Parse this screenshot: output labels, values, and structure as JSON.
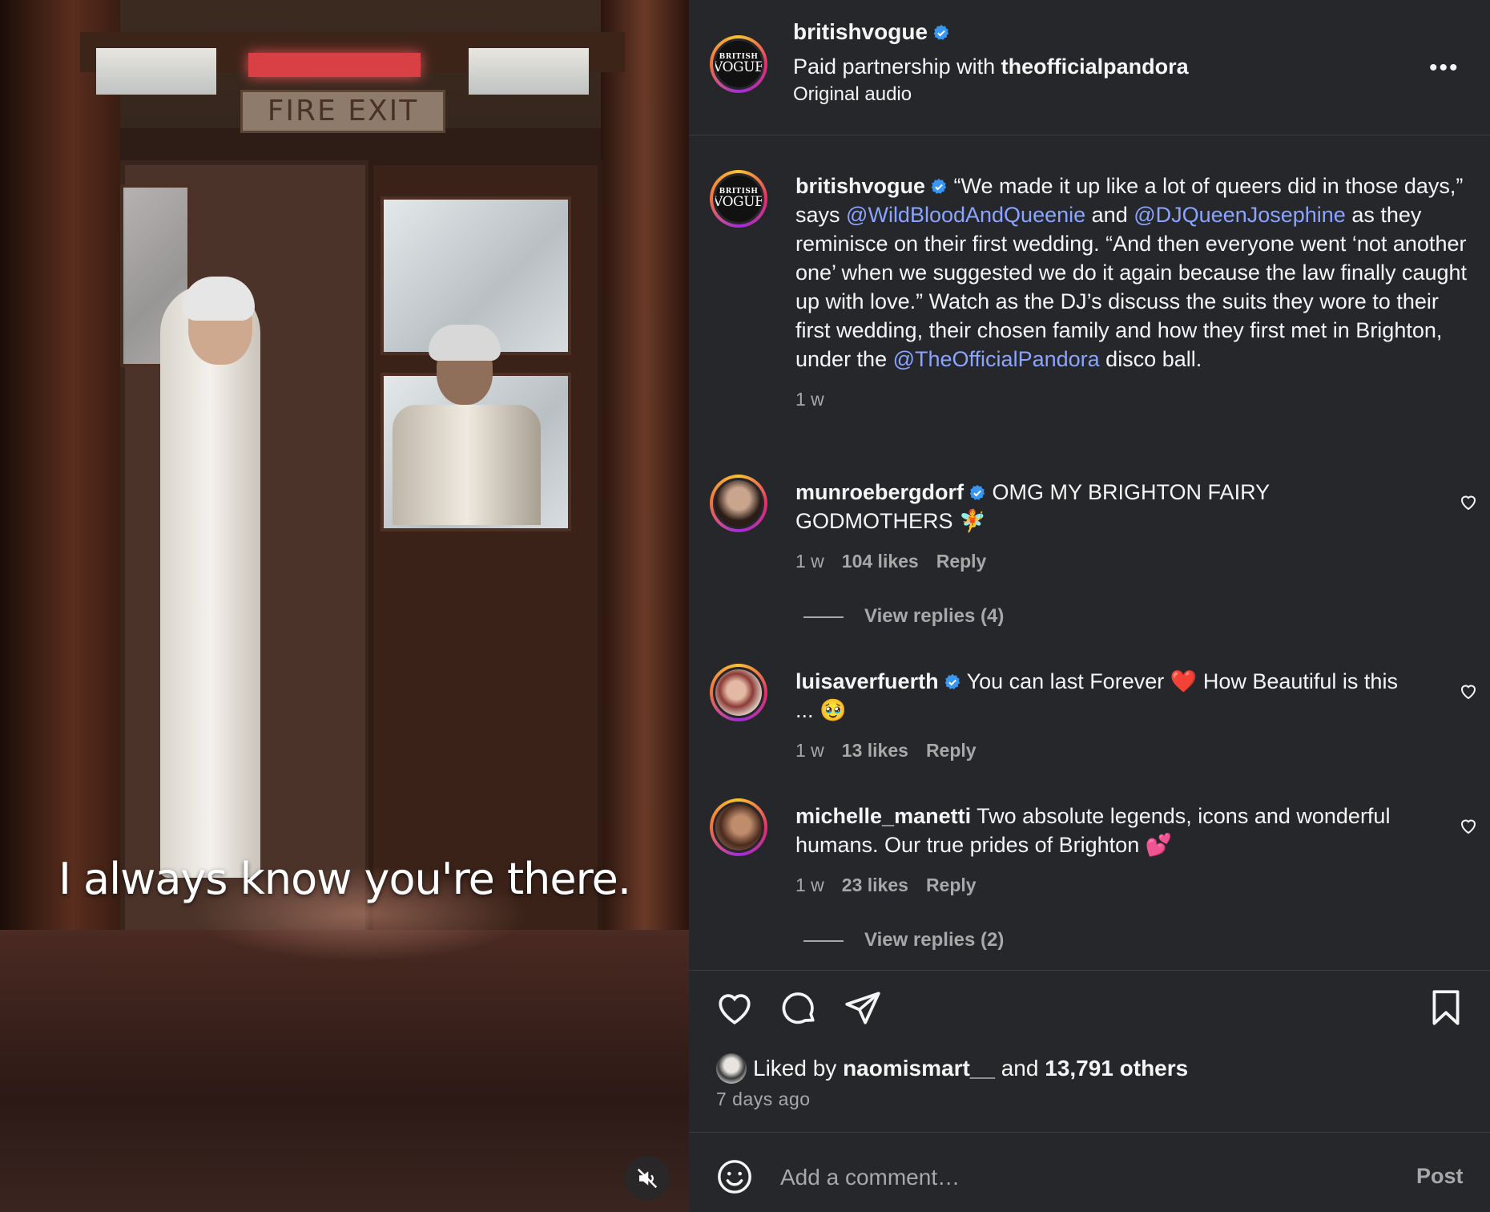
{
  "video": {
    "subtitle": "I always know you're there.",
    "exit_sign_text": "FIRE EXIT",
    "mute_icon": "speaker-muted-icon"
  },
  "header": {
    "username": "britishvogue",
    "verified_icon": "verified-badge-icon",
    "partnership_prefix": "Paid partnership with",
    "partner": "theofficialpandora",
    "audio": "Original audio",
    "more_icon": "more-options-icon",
    "more_label": "•••",
    "logo_line1": "BRITISH",
    "logo_line2": "VOGUE"
  },
  "caption": {
    "username": "britishvogue",
    "text_1": "“We made it up like a lot of queers did in those days,” says",
    "mention_1": "@WildBloodAndQueenie",
    "text_2": "and",
    "mention_2": "@DJQueenJosephine",
    "text_3": "as they reminisce on their first wedding. “And then everyone went ‘not another one’ when we suggested we do it again because the law finally caught up with love.” Watch as the DJ’s discuss the suits they wore to their first wedding, their chosen family and how they first met in Brighton, under the",
    "mention_3": "@TheOfficialPandora",
    "text_4": "disco ball.",
    "time": "1 w"
  },
  "comments": [
    {
      "username": "munroebergdorf",
      "text": "OMG MY BRIGHTON FAIRY GODMOTHERS 🧚",
      "time": "1 w",
      "likes": "104 likes",
      "reply": "Reply",
      "view_replies": "View replies (4)"
    },
    {
      "username": "luisaverfuerth",
      "text": "You can last Forever ❤️ How Beautiful is this ... 🥹",
      "time": "1 w",
      "likes": "13 likes",
      "reply": "Reply"
    },
    {
      "username": "michelle_manetti",
      "text": "Two absolute legends, icons and wonderful humans. Our true prides of Brighton 💕",
      "time": "1 w",
      "likes": "23 likes",
      "reply": "Reply",
      "view_replies": "View replies (2)"
    }
  ],
  "actions": {
    "like_icon": "heart-icon",
    "comment_icon": "comment-bubble-icon",
    "share_icon": "paper-plane-icon",
    "save_icon": "bookmark-icon"
  },
  "likes": {
    "prefix": "Liked by",
    "user": "naomismart__",
    "middle": "and",
    "count": "13,791 others"
  },
  "posted": "7 days ago",
  "composer": {
    "emoji_icon": "smiley-icon",
    "placeholder": "Add a comment…",
    "post_label": "Post"
  },
  "colors": {
    "background": "#25272b",
    "mention": "#8aa4ff",
    "verified": "#3897f0",
    "muted_text": "#a8a8a8"
  }
}
